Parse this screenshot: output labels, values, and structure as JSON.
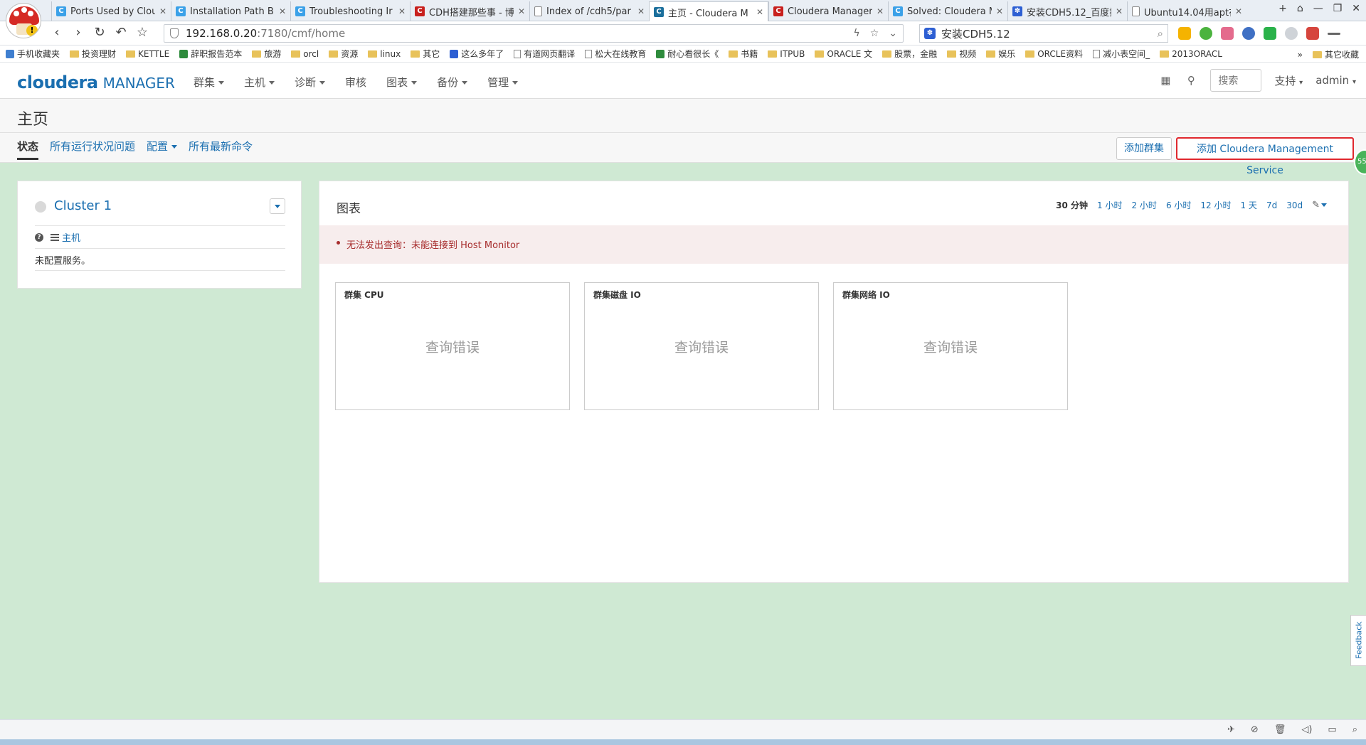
{
  "browser": {
    "tabs": [
      {
        "title": "Ports Used by Clou",
        "favicon": "confluence-c",
        "color": "#3ba1e8",
        "active": false
      },
      {
        "title": "Installation Path B",
        "favicon": "confluence-c",
        "color": "#3ba1e8",
        "active": false
      },
      {
        "title": "Troubleshooting Ir",
        "favicon": "confluence-c",
        "color": "#3ba1e8",
        "active": false
      },
      {
        "title": "CDH搭建那些事 - 博",
        "favicon": "csdn-c",
        "color": "#c8201d",
        "active": false
      },
      {
        "title": "Index of /cdh5/par",
        "favicon": "page",
        "color": "#ffffff",
        "active": false
      },
      {
        "title": "主页 - Cloudera M",
        "favicon": "confluence-c",
        "color": "#1b6f9c",
        "active": true
      },
      {
        "title": "Cloudera Manager",
        "favicon": "csdn-c",
        "color": "#c8201d",
        "active": false
      },
      {
        "title": "Solved: Cloudera M",
        "favicon": "confluence-c",
        "color": "#3ba1e8",
        "active": false
      },
      {
        "title": "安装CDH5.12_百度搜",
        "favicon": "baidu-paw",
        "color": "#2d5fd3",
        "active": false
      },
      {
        "title": "Ubuntu14.04用apt在",
        "favicon": "page",
        "color": "#ffffff",
        "active": false
      }
    ],
    "url_host": "192.168.0.20",
    "url_path": ":7180/cmf/home",
    "search_text": "安装CDH5.12",
    "bookmarks": [
      {
        "label": "手机收藏夹",
        "icon": "phone-icon"
      },
      {
        "label": "投资理财",
        "icon": "folder-icon"
      },
      {
        "label": "KETTLE",
        "icon": "folder-icon"
      },
      {
        "label": "辞职报告范本",
        "icon": "green-icon"
      },
      {
        "label": "旅游",
        "icon": "folder-icon"
      },
      {
        "label": "orcl",
        "icon": "folder-icon"
      },
      {
        "label": "资源",
        "icon": "folder-icon"
      },
      {
        "label": "linux",
        "icon": "folder-icon"
      },
      {
        "label": "其它",
        "icon": "folder-icon"
      },
      {
        "label": "这么多年了",
        "icon": "baidu-icon"
      },
      {
        "label": "有道网页翻译",
        "icon": "page-icon"
      },
      {
        "label": "松大在线教育",
        "icon": "page-icon"
      },
      {
        "label": "耐心看很长《",
        "icon": "green-icon"
      },
      {
        "label": "书籍",
        "icon": "folder-icon"
      },
      {
        "label": "ITPUB",
        "icon": "folder-icon"
      },
      {
        "label": "ORACLE 文",
        "icon": "folder-icon"
      },
      {
        "label": "股票，金融",
        "icon": "folder-icon"
      },
      {
        "label": "视频",
        "icon": "folder-icon"
      },
      {
        "label": "娱乐",
        "icon": "folder-icon"
      },
      {
        "label": "ORCLE资料",
        "icon": "folder-icon"
      },
      {
        "label": "减小表空间_",
        "icon": "page-icon"
      },
      {
        "label": "2013ORACL",
        "icon": "folder-icon"
      }
    ],
    "bookmarks_more": "»",
    "other_bookmarks": "其它收藏"
  },
  "header": {
    "logo_main": "cloudera",
    "logo_sub": "MANAGER",
    "nav": [
      "群集",
      "主机",
      "诊断",
      "审核",
      "图表",
      "备份",
      "管理"
    ],
    "nav_has_caret": [
      true,
      true,
      true,
      false,
      true,
      true,
      true
    ],
    "search_placeholder": "搜索",
    "support": "支持",
    "user": "admin"
  },
  "page": {
    "title": "主页",
    "subtabs": [
      "状态",
      "所有运行状况问题",
      "配置",
      "所有最新命令"
    ],
    "add_cluster": "添加群集",
    "add_cms": "添加 Cloudera Management Service",
    "side_badge": "55"
  },
  "cluster": {
    "name": "Cluster 1",
    "hosts_link": "主机",
    "no_services": "未配置服务。"
  },
  "charts": {
    "title": "图表",
    "time_ranges": [
      "30 分钟",
      "1 小时",
      "2 小时",
      "6 小时",
      "12 小时",
      "1 天",
      "7d",
      "30d"
    ],
    "active_range": "30 分钟",
    "error_message": "无法发出查询：未能连接到 Host Monitor",
    "boxes": [
      {
        "title": "群集 CPU",
        "message": "查询错误"
      },
      {
        "title": "群集磁盘 IO",
        "message": "查询错误"
      },
      {
        "title": "群集网络 IO",
        "message": "查询错误"
      }
    ]
  },
  "feedback": "Feedback"
}
